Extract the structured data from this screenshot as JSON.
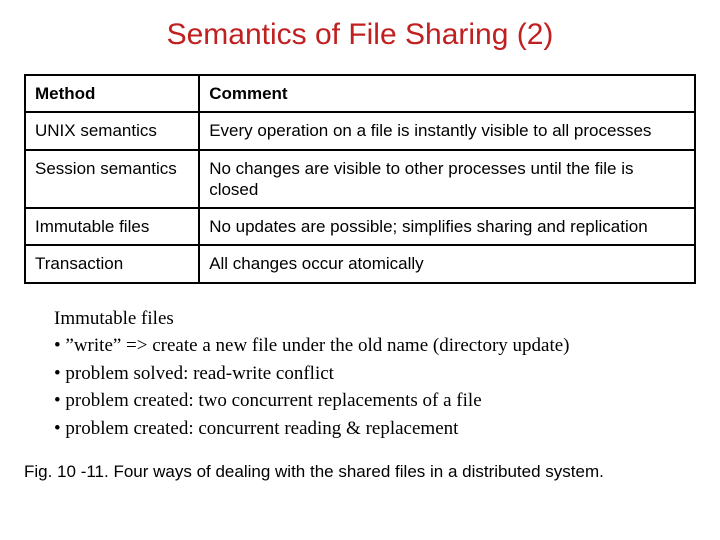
{
  "title": "Semantics of File Sharing (2)",
  "table": {
    "headers": [
      "Method",
      "Comment"
    ],
    "rows": [
      {
        "method": "UNIX semantics",
        "comment": "Every operation on a file is instantly visible to all processes"
      },
      {
        "method": "Session semantics",
        "comment": "No changes are visible to other processes until the file is closed"
      },
      {
        "method": "Immutable files",
        "comment": "No updates are possible; simplifies sharing and replication"
      },
      {
        "method": "Transaction",
        "comment": "All changes occur atomically"
      }
    ]
  },
  "notes": {
    "heading": "Immutable files",
    "bullets": [
      "”write” => create a new file  under the old name (directory update)",
      "problem solved: read-write conflict",
      "problem created: two concurrent replacements of a file",
      "problem created: concurrent reading & replacement"
    ]
  },
  "caption": "Fig. 10 -11. Four ways of dealing with the shared files in a distributed system."
}
